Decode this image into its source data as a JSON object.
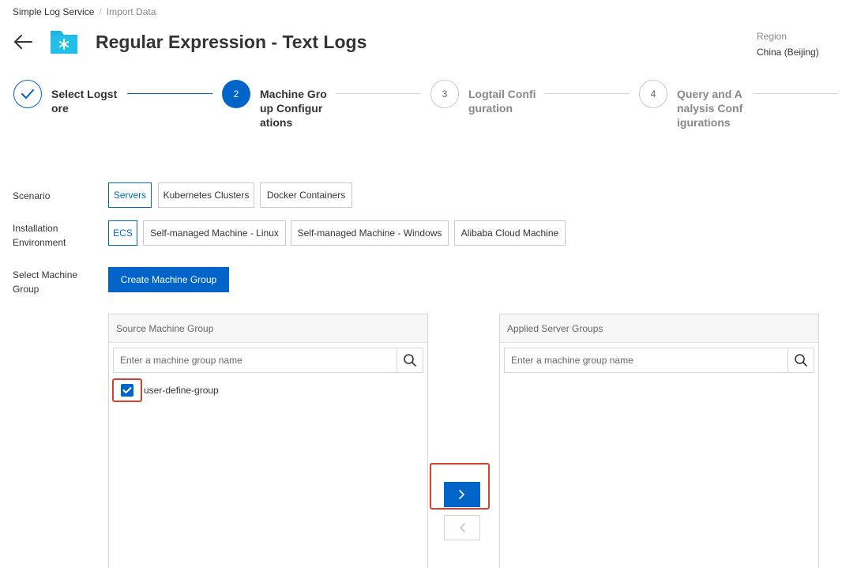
{
  "breadcrumb": {
    "root": "Simple Log Service",
    "separator": "/",
    "current": "Import Data"
  },
  "header": {
    "title": "Regular Expression - Text Logs",
    "icon": "folder-star-icon"
  },
  "region": {
    "label": "Region",
    "value": "China (Beijing)"
  },
  "steps": [
    {
      "number": "",
      "label": "Select Logstore",
      "status": "done"
    },
    {
      "number": "2",
      "label": "Machine Group Configurations",
      "status": "active"
    },
    {
      "number": "3",
      "label": "Logtail Configuration",
      "status": "todo"
    },
    {
      "number": "4",
      "label": "Query and Analysis Configurations",
      "status": "todo"
    }
  ],
  "scenario": {
    "label": "Scenario",
    "options": [
      "Servers",
      "Kubernetes Clusters",
      "Docker Containers"
    ],
    "selected": "Servers"
  },
  "installation": {
    "label": "Installation Environment",
    "options": [
      "ECS",
      "Self-managed Machine - Linux",
      "Self-managed Machine - Windows",
      "Alibaba Cloud Machine"
    ],
    "selected": "ECS"
  },
  "machine_group": {
    "label": "Select Machine Group",
    "create_label": "Create Machine Group"
  },
  "source_panel": {
    "title": "Source Machine Group",
    "placeholder": "Enter a machine group name",
    "items": [
      {
        "name": "user-define-group",
        "checked": true
      }
    ]
  },
  "applied_panel": {
    "title": "Applied Server Groups",
    "placeholder": "Enter a machine group name",
    "items": []
  },
  "transfer": {
    "right_symbol": ">",
    "left_symbol": "<"
  },
  "colors": {
    "primary": "#0064c8",
    "highlight": "#d7402b",
    "border": "#d6d6d6",
    "icon": "#1fb3e6"
  }
}
